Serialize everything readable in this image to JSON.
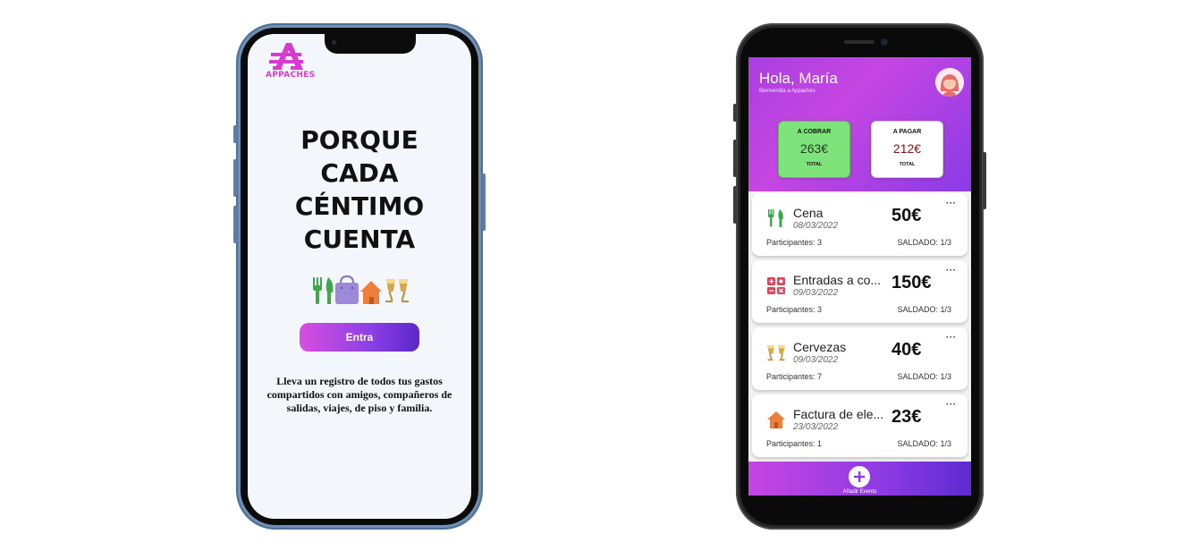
{
  "onboarding": {
    "logo_text": "APPACHES",
    "headline": [
      "PORQUE",
      "CADA",
      "CÉNTIMO",
      "CUENTA"
    ],
    "enter_label": "Entra",
    "tagline_lines": [
      "Lleva un registro de todos tus gastos",
      "compartidos con amigos, compañeros de",
      "salidas, viajes, de piso y familia."
    ],
    "brand_color": "#d93ad4",
    "category_icons": [
      "fork-knife-icon",
      "shopping-bag-icon",
      "house-icon",
      "cheers-icon"
    ]
  },
  "dashboard": {
    "greeting": "Hola, María",
    "welcome": "Bienvenida a Appaches",
    "cobrar": {
      "title": "A COBRAR",
      "amount": "263€",
      "total": "TOTAL",
      "color": "#7de37a"
    },
    "pagar": {
      "title": "A PAGAR",
      "amount": "212€",
      "total": "TOTAL",
      "color": "#8a1420"
    },
    "events": [
      {
        "icon": "fork-knife-icon",
        "name": "Cena",
        "date": "08/03/2022",
        "amount": "50€",
        "participants": "Participantes: 3",
        "status": "SALDADO: 1/3",
        "menu": "···"
      },
      {
        "icon": "tickets-icon",
        "name": "Entradas a co...",
        "date": "09/03/2022",
        "amount": "150€",
        "participants": "Participantes: 3",
        "status": "SALDADO: 1/3",
        "menu": "···"
      },
      {
        "icon": "cheers-icon",
        "name": "Cervezas",
        "date": "09/03/2022",
        "amount": "40€",
        "participants": "Participantes: 7",
        "status": "SALDADO: 1/3",
        "menu": "···"
      },
      {
        "icon": "house-icon",
        "name": "Factura de ele...",
        "date": "23/03/2022",
        "amount": "23€",
        "participants": "Participantes: 1",
        "status": "SALDADO: 1/3",
        "menu": "···"
      }
    ],
    "add_event_label": "Añadir Evento"
  }
}
